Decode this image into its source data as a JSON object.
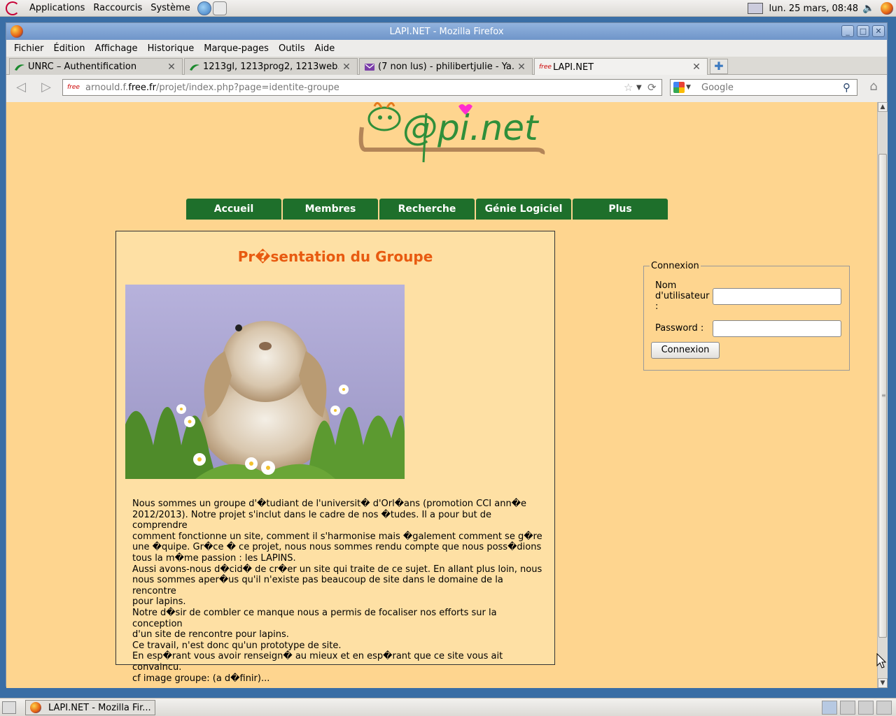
{
  "top_panel": {
    "menus": [
      "Applications",
      "Raccourcis",
      "Système"
    ],
    "clock": "lun. 25 mars, 08:48"
  },
  "window": {
    "title": "LAPI.NET - Mozilla Firefox",
    "buttons": [
      "_",
      "□",
      "✕"
    ]
  },
  "menubar": [
    "Fichier",
    "Édition",
    "Affichage",
    "Historique",
    "Marque-pages",
    "Outils",
    "Aide"
  ],
  "tabs": [
    {
      "label": "UNRC – Authentification",
      "icon": "unrc-icon",
      "active": false
    },
    {
      "label": "1213gl, 1213prog2, 1213web...",
      "icon": "unrc-icon",
      "active": false
    },
    {
      "label": "(7 non lus) - philibertjulie - Ya...",
      "icon": "mail-icon",
      "active": false
    },
    {
      "label": "LAPI.NET",
      "icon": "free-icon",
      "active": true
    }
  ],
  "urlbar": {
    "favicon": "free",
    "url_prefix": "arnould.f.",
    "url_domain": "free.fr",
    "url_suffix": "/projet/index.php?page=identite-groupe"
  },
  "searchbar": {
    "placeholder": "Google"
  },
  "site": {
    "logo_text": "@pi.net",
    "nav": [
      "Accueil",
      "Membres",
      "Recherche",
      "Génie Logiciel",
      "Plus"
    ],
    "heading": "Pr�sentation du Groupe",
    "paragraph_lines": [
      "Nous sommes un groupe d'�tudiant de l'universit� d'Orl�ans (promotion CCI ann�e",
      "2012/2013). Notre projet s'inclut dans le cadre de nos �tudes. Il a pour but de comprendre",
      "comment fonctionne un site, comment il s'harmonise mais �galement comment se g�re",
      "une �quipe. Gr�ce � ce projet, nous nous sommes rendu compte que nous poss�dions",
      "tous la m�me passion : les LAPINS.",
      "Aussi avons-nous d�cid� de cr�er un site qui traite de ce sujet. En allant plus loin, nous",
      "nous sommes aper�us qu'il n'existe pas beaucoup de site dans le domaine de la rencontre",
      "pour lapins.",
      "Notre d�sir de combler ce manque nous a permis de focaliser nos efforts sur la conception",
      "d'un site de rencontre pour lapins.",
      "Ce travail, n'est donc qu'un prototype de site.",
      "En esp�rant vous avoir renseign� au mieux et en esp�rant que ce site vous ait convaincu.",
      "cf image groupe: (a d�finir)..."
    ],
    "login": {
      "legend": "Connexion",
      "username_label_lines": [
        "Nom",
        "d'utilisateur",
        ":"
      ],
      "username_value": "",
      "password_label": "Password :",
      "password_value": "",
      "submit": "Connexion"
    }
  },
  "taskbar": {
    "task_label": "LAPI.NET - Mozilla Fir..."
  },
  "colors": {
    "page_bg": "#fed58f",
    "nav_green": "#1e6f2b",
    "heading_orange": "#e85a10",
    "box_bg": "#fee0a4"
  }
}
